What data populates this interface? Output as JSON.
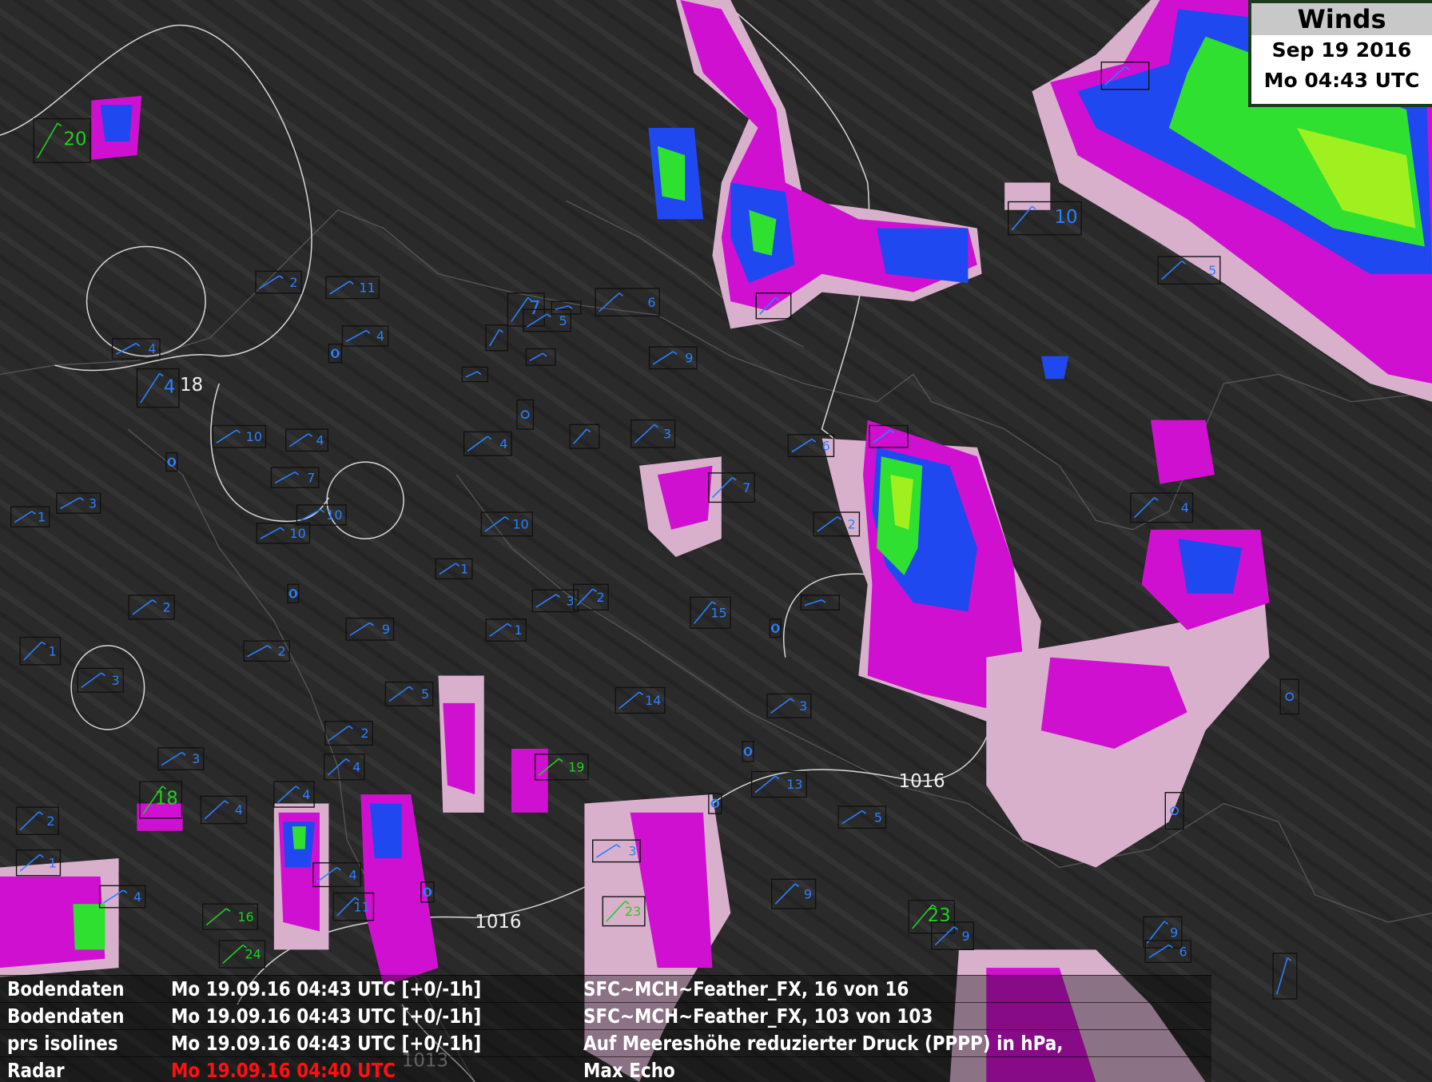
{
  "title_box": {
    "title": "Winds",
    "date": "Sep 19 2016",
    "time": "Mo 04:43 UTC"
  },
  "legend": [
    {
      "layer": "Bodendaten",
      "time": "Mo 19.09.16 04:43 UTC [+0/-1h]",
      "description": "SFC~MCH~Feather_FX, 16 von 16"
    },
    {
      "layer": "Bodendaten",
      "time": "Mo 19.09.16 04:43 UTC [+0/-1h]",
      "description": "SFC~MCH~Feather_FX, 103 von 103"
    },
    {
      "layer": "prs isolines",
      "time": "Mo 19.09.16 04:43 UTC [+0/-1h]",
      "description": "Auf Meereshöhe reduzierter Druck (PPPP) in hPa,"
    },
    {
      "layer": "Radar",
      "time": "Mo 19.09.16 04:40 UTC",
      "description": "Max Echo",
      "time_color": "#ff1010"
    }
  ],
  "isoline_labels": [
    "18",
    "1016",
    "1016",
    "1013"
  ],
  "station_values": [
    "20",
    "2",
    "11",
    "4",
    "0",
    "4",
    "4",
    "10",
    "4",
    "7",
    "0",
    "10",
    "10",
    "1",
    "3",
    "2",
    "0",
    "1",
    "2",
    "9",
    "3",
    "5",
    "2",
    "3",
    "4",
    "18",
    "4",
    "4",
    "2",
    "1",
    "4",
    "16",
    "24",
    "4",
    "11",
    "0",
    "4",
    "10",
    "1",
    "1",
    "3",
    "2",
    "7",
    "5",
    "6",
    "9",
    "3",
    "",
    "",
    "",
    "",
    "",
    "7",
    "6",
    "2",
    "15",
    "0",
    "",
    "14",
    "19",
    "3",
    "0",
    "13",
    "0",
    "5",
    "3",
    "9",
    "23",
    "23",
    "9",
    "9",
    "6",
    "10",
    "5",
    "4",
    "",
    "",
    "",
    "",
    "",
    "",
    ""
  ],
  "colors": {
    "background": "#2a2a2a",
    "wind_label": "#2a80ff",
    "wind_label_strong": "#20d020",
    "radar_light": "#d8b0cc",
    "radar_mid": "#d010d0",
    "radar_dark": "#900090",
    "radar_blue": "#2048f0",
    "radar_green": "#30e030",
    "radar_lime": "#a0f020"
  }
}
